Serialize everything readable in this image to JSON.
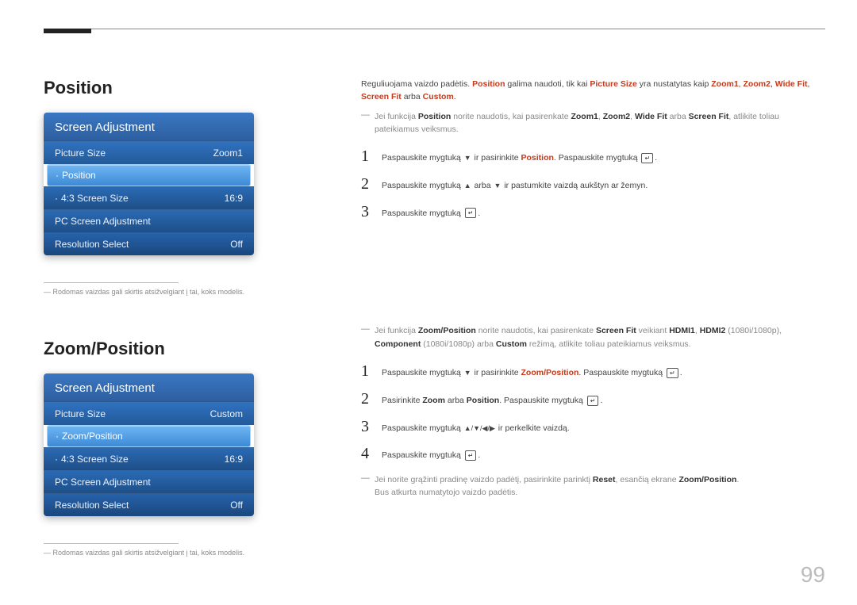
{
  "page_number": "99",
  "section1": {
    "title": "Position",
    "menu": {
      "header": "Screen Adjustment",
      "rows": [
        {
          "label": "Picture Size",
          "value": "Zoom1",
          "cls": "menu-body-a"
        },
        {
          "label": "Position",
          "value": "",
          "highlight": true
        },
        {
          "label": "4:3 Screen Size",
          "value": "16:9",
          "cls": "menu-body-b"
        },
        {
          "label": "PC Screen Adjustment",
          "value": "",
          "cls": "menu-body-b"
        },
        {
          "label": "Resolution Select",
          "value": "Off",
          "cls": "menu-body-c"
        }
      ]
    },
    "footnote": "Rodomas vaizdas gali skirtis atsižvelgiant į tai, koks modelis.",
    "intro": {
      "pre": "Reguliuojama vaizdo padėtis. ",
      "t_position": "Position",
      "mid1": " galima naudoti, tik kai ",
      "t_ps": "Picture Size",
      "mid2": " yra nustatytas kaip ",
      "t_z1": "Zoom1",
      "t_z2": "Zoom2",
      "t_wf": "Wide Fit",
      "t_sf": "Screen Fit",
      "t_arba": " arba ",
      "t_custom": "Custom",
      "dot": "."
    },
    "note": {
      "a": "Jei funkcija ",
      "b": "Position",
      "c": " norite naudotis, kai pasirenkate ",
      "d": "Zoom1",
      "e": "Zoom2",
      "f": "Wide Fit",
      "g": " arba ",
      "h": "Screen Fit",
      "i": ", atlikite toliau pateikiamus veiksmus."
    },
    "steps": [
      {
        "pre": "Paspauskite mygtuką ",
        "sym1": "▼",
        "mid": " ir pasirinkite ",
        "red": "Position",
        "post": ". Paspauskite mygtuką ",
        "enter": "↵",
        "end": "."
      },
      {
        "pre": "Paspauskite mygtuką ",
        "sym1": "▲",
        "mid": " arba ",
        "sym2": "▼",
        "post": " ir pastumkite vaizdą aukštyn ar žemyn."
      },
      {
        "pre": "Paspauskite mygtuką ",
        "enter": "↵",
        "end": "."
      }
    ]
  },
  "section2": {
    "title": "Zoom/Position",
    "menu": {
      "header": "Screen Adjustment",
      "rows": [
        {
          "label": "Picture Size",
          "value": "Custom",
          "cls": "menu-body-a"
        },
        {
          "label": "Zoom/Position",
          "value": "",
          "highlight": true
        },
        {
          "label": "4:3 Screen Size",
          "value": "16:9",
          "cls": "menu-body-b"
        },
        {
          "label": "PC Screen Adjustment",
          "value": "",
          "cls": "menu-body-b"
        },
        {
          "label": "Resolution Select",
          "value": "Off",
          "cls": "menu-body-c"
        }
      ]
    },
    "footnote": "Rodomas vaizdas gali skirtis atsižvelgiant į tai, koks modelis.",
    "note": {
      "a": "Jei funkcija ",
      "b": "Zoom/Position",
      "c": " norite naudotis, kai pasirenkate ",
      "d": "Screen Fit",
      "e": " veikiant ",
      "f": "HDMI1",
      "g": "HDMI2",
      "h": " (1080i/1080p), ",
      "i": "Component",
      "j": " (1080i/1080p) arba ",
      "k": "Custom",
      "l": " režimą, atlikite toliau pateikiamus veiksmus."
    },
    "steps": [
      {
        "pre": "Paspauskite mygtuką ",
        "sym1": "▼",
        "mid": " ir pasirinkite ",
        "red": "Zoom/Position",
        "post": ". Paspauskite mygtuką ",
        "enter": "↵",
        "end": "."
      },
      {
        "pre": "Pasirinkite ",
        "b1": "Zoom",
        "mid": " arba ",
        "b2": "Position",
        "post": ". Paspauskite mygtuką ",
        "enter": "↵",
        "end": "."
      },
      {
        "pre": "Paspauskite mygtuką ",
        "arrows": "▲/▼/◀/▶",
        "post": " ir perkelkite vaizdą."
      },
      {
        "pre": "Paspauskite mygtuką ",
        "enter": "↵",
        "end": "."
      }
    ],
    "note2": {
      "a": "Jei norite grąžinti pradinę vaizdo padėtį, pasirinkite parinktį ",
      "b": "Reset",
      "c": ", esančią ekrane ",
      "d": "Zoom/Position",
      "e": ".",
      "f": "Bus atkurta numatytojo vaizdo padėtis."
    }
  }
}
